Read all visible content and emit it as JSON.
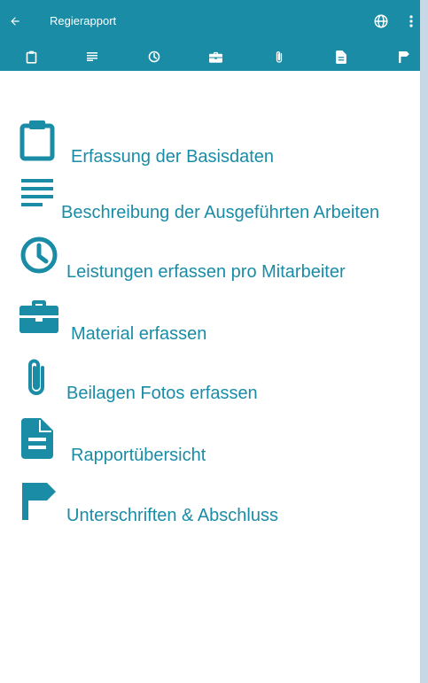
{
  "app": {
    "title": "Regierapport"
  },
  "toolbar": {
    "back_icon": "arrow-left-icon",
    "language_icon": "globe-icon",
    "overflow_icon": "more-vertical-icon"
  },
  "tabs": [
    {
      "icon": "clipboard-icon"
    },
    {
      "icon": "notes-icon"
    },
    {
      "icon": "clock-icon"
    },
    {
      "icon": "briefcase-icon"
    },
    {
      "icon": "paperclip-icon"
    },
    {
      "icon": "document-icon"
    },
    {
      "icon": "flag-icon"
    }
  ],
  "menu": {
    "items": [
      {
        "label": "Erfassung der Basisdaten",
        "icon": "clipboard-icon"
      },
      {
        "label": "Beschreibung der Ausgeführten Arbeiten",
        "icon": "notes-icon"
      },
      {
        "label": "Leistungen erfassen pro Mitarbeiter",
        "icon": "clock-icon"
      },
      {
        "label": "Material erfassen",
        "icon": "briefcase-icon"
      },
      {
        "label": "Beilagen Fotos erfassen",
        "icon": "paperclip-icon"
      },
      {
        "label": "Rapportübersicht",
        "icon": "document-icon"
      },
      {
        "label": "Unterschriften & Abschluss",
        "icon": "flag-icon"
      }
    ]
  },
  "colors": {
    "primary": "#1a8ca6",
    "background": "#ffffff",
    "frame": "#c6d8e6"
  }
}
